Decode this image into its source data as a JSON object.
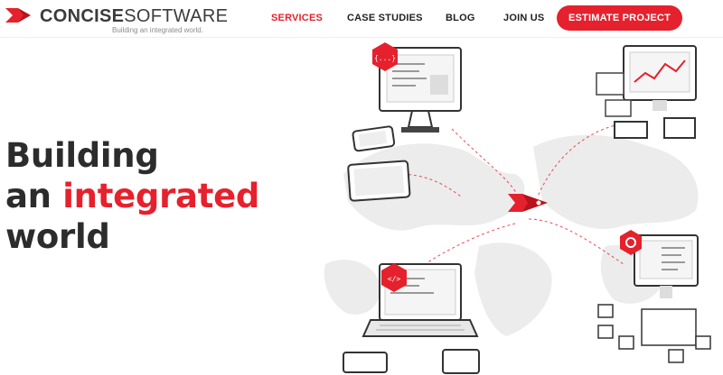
{
  "brand": {
    "name_bold": "CONCISE",
    "name_light": "SOFTWARE",
    "tagline": "Building an integrated world.",
    "accent_color": "#e5212d"
  },
  "nav": {
    "items": [
      {
        "label": "SERVICES",
        "active": true
      },
      {
        "label": "CASE STUDIES",
        "active": false
      },
      {
        "label": "BLOG",
        "active": false
      },
      {
        "label": "JOIN US",
        "active": false
      }
    ],
    "cta_label": "ESTIMATE PROJECT"
  },
  "hero": {
    "line1": "Building",
    "line2_prefix": "an ",
    "line2_accent": "integrated",
    "line3": "world"
  },
  "illustration": {
    "badges": [
      "{...}",
      "</>"
    ],
    "icons": [
      "world-map",
      "rocket-icon",
      "desktop-monitor",
      "tablet",
      "smartphone",
      "laptop",
      "server-cubes"
    ]
  }
}
